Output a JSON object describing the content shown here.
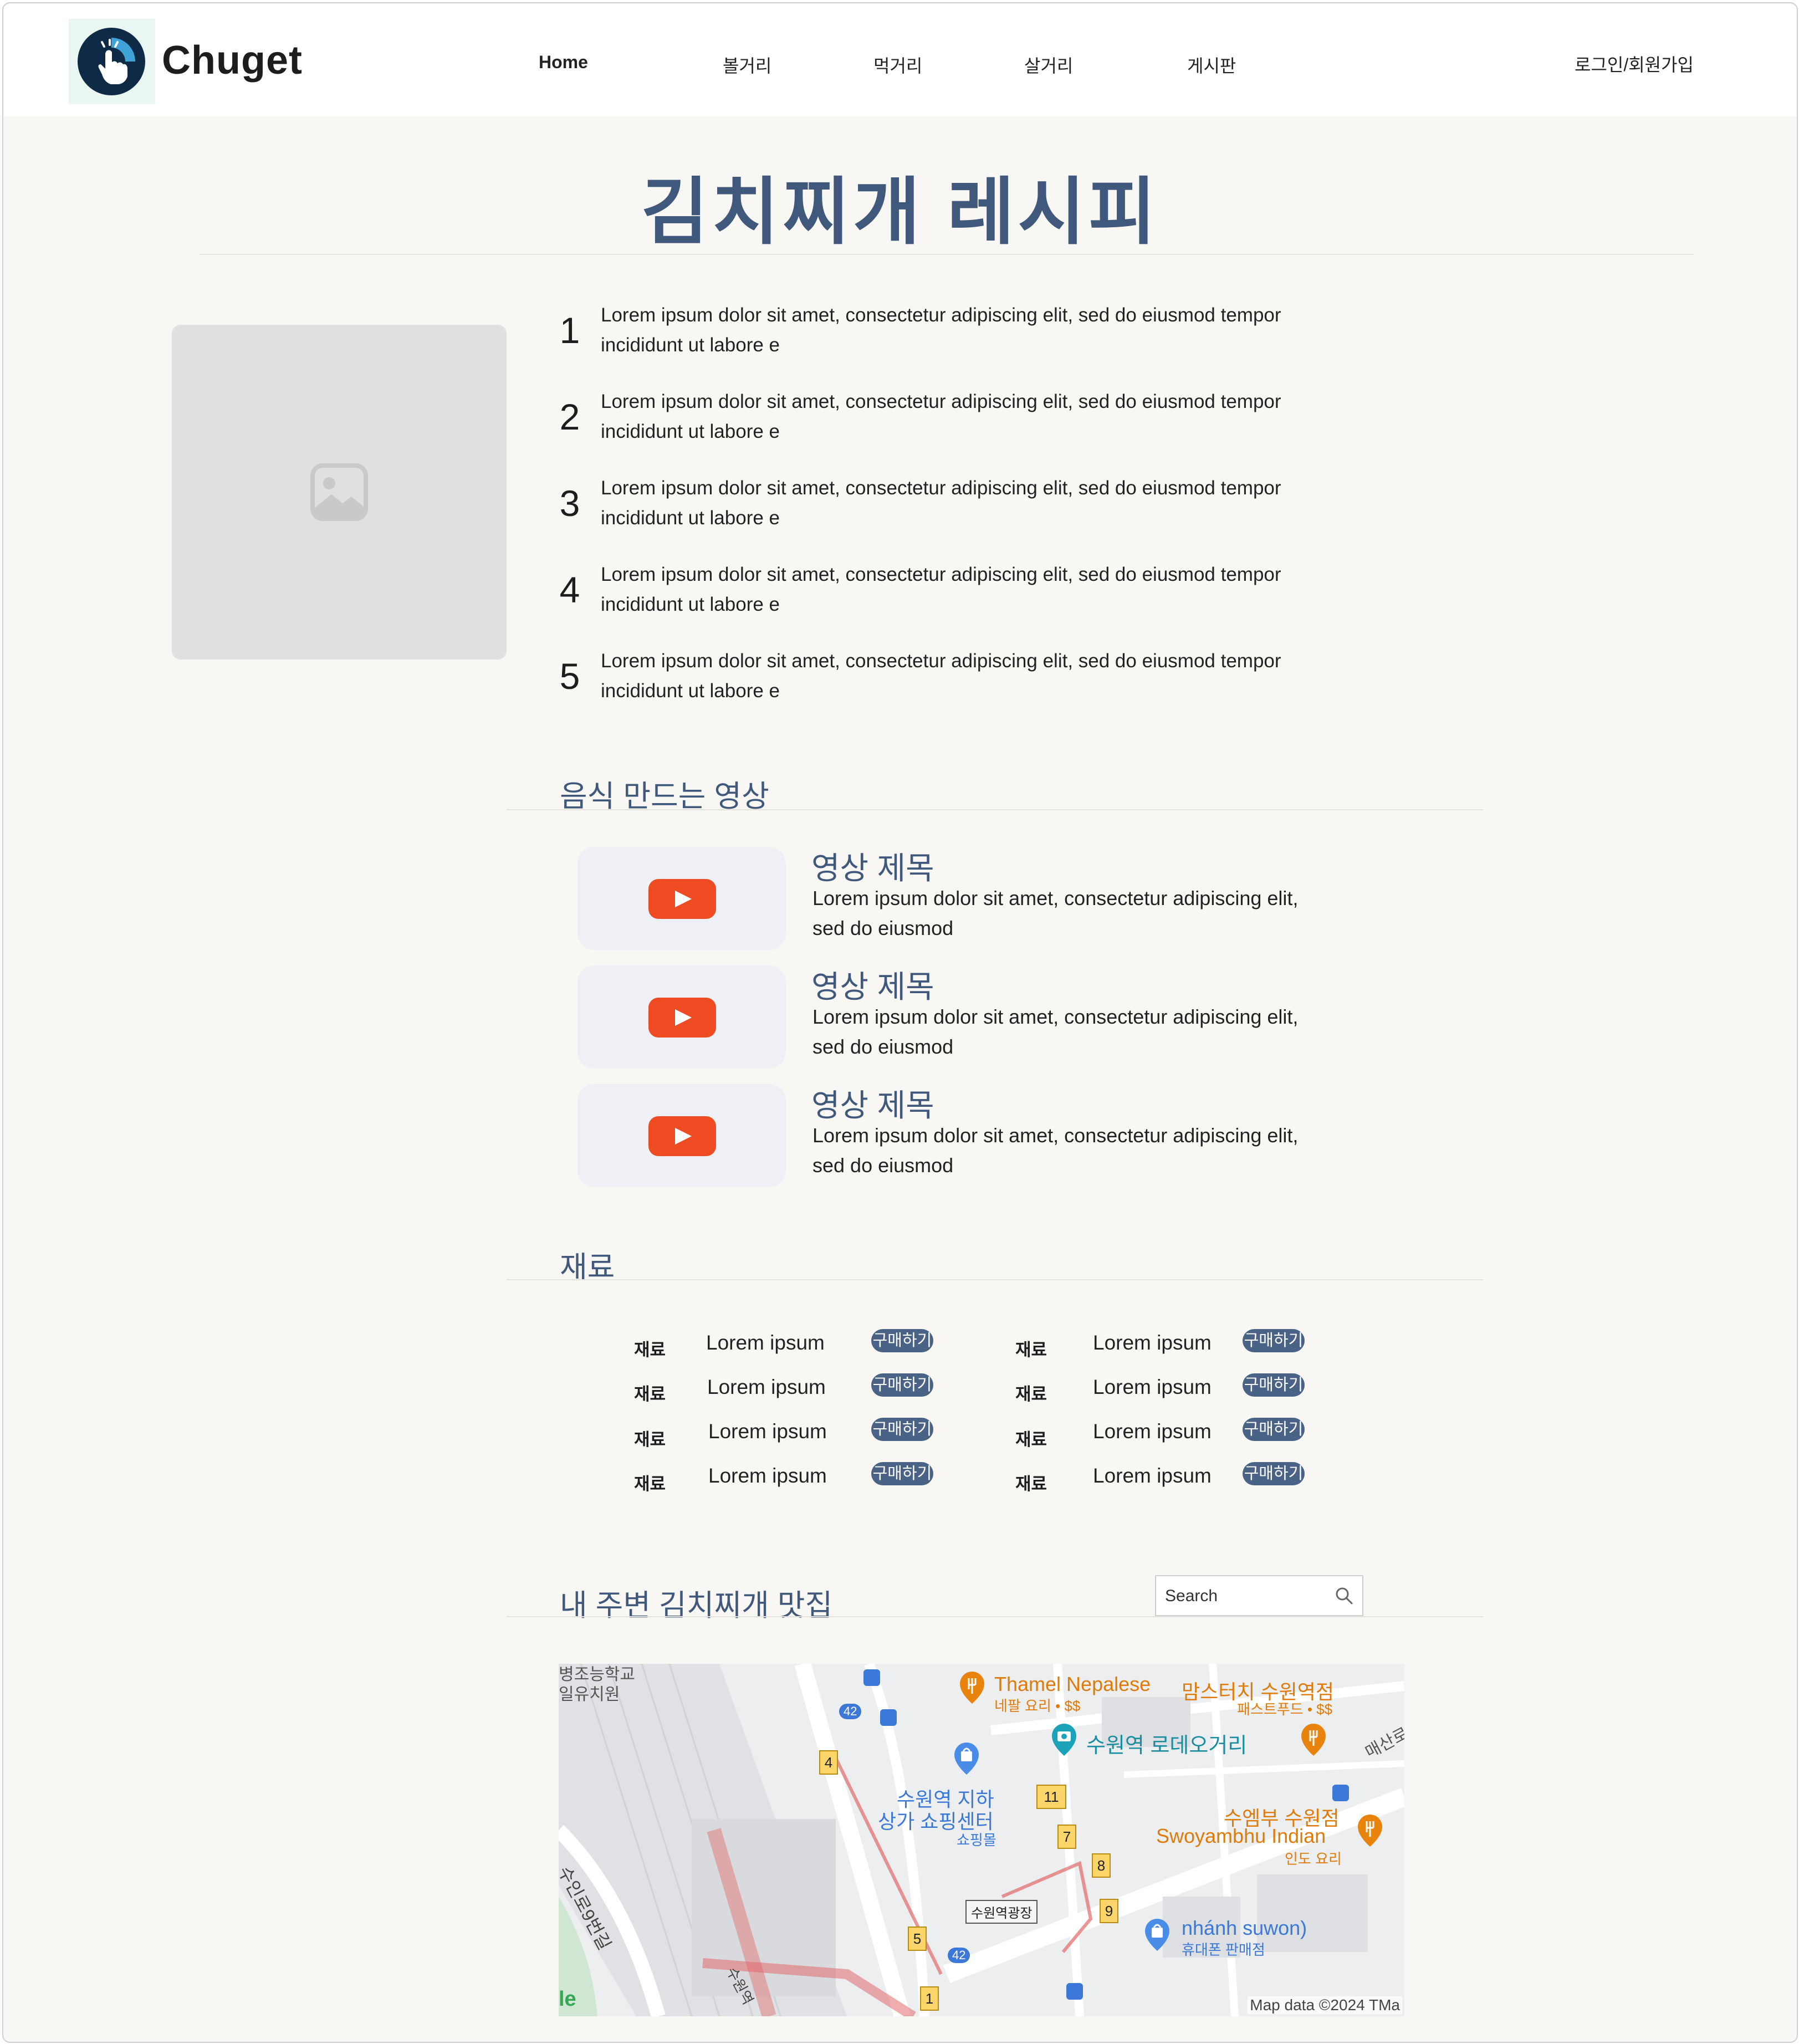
{
  "header": {
    "brand": "Chuget",
    "nav": [
      "Home",
      "볼거리",
      "먹거리",
      "살거리",
      "게시판"
    ],
    "login": "로그인/회원가입"
  },
  "recipe": {
    "title": "김치찌개 레시피",
    "steps": [
      {
        "num": "1",
        "line1": "Lorem ipsum dolor sit amet, consectetur adipiscing elit, sed do eiusmod tempor",
        "line2": "incididunt ut labore e"
      },
      {
        "num": "2",
        "line1": "Lorem ipsum dolor sit amet, consectetur adipiscing elit, sed do eiusmod tempor",
        "line2": "incididunt ut labore e"
      },
      {
        "num": "3",
        "line1": "Lorem ipsum dolor sit amet, consectetur adipiscing elit, sed do eiusmod tempor",
        "line2": "incididunt ut labore e"
      },
      {
        "num": "4",
        "line1": "Lorem ipsum dolor sit amet, consectetur adipiscing elit, sed do eiusmod tempor",
        "line2": "incididunt ut labore e"
      },
      {
        "num": "5",
        "line1": "Lorem ipsum dolor sit amet, consectetur adipiscing elit, sed do eiusmod tempor",
        "line2": "incididunt ut labore e"
      }
    ]
  },
  "videos": {
    "section_title": "음식 만드는 영상",
    "items": [
      {
        "title": "영상 제목",
        "line1": "Lorem ipsum dolor sit amet, consectetur adipiscing elit,",
        "line2": "sed do eiusmod"
      },
      {
        "title": "영상 제목",
        "line1": "Lorem ipsum dolor sit amet, consectetur adipiscing elit,",
        "line2": "sed do eiusmod"
      },
      {
        "title": "영상 제목",
        "line1": "Lorem ipsum dolor sit amet, consectetur adipiscing elit,",
        "line2": "sed do eiusmod"
      }
    ]
  },
  "ingredients": {
    "section_title": "재료",
    "label": "재료",
    "name": "Lorem ipsum",
    "buy_label": "구매하기",
    "rows": 4,
    "columns": 2
  },
  "nearby": {
    "section_title": "내 주변 김치찌개 맛집",
    "search_placeholder": "Search",
    "map": {
      "attribution": "Map data ©2024 TMa",
      "google_fragment": "le",
      "labels": {
        "school1": "병조능학교",
        "school2": "일유치원",
        "thamel": "Thamel Nepalese",
        "thamel_sub": "네팔 요리 • $$",
        "mom": "맘스터치 수원역점",
        "mom_sub": "패스트푸드 • $$",
        "rodeo": "수원역 로데오거리",
        "maesan": "매산로",
        "underground1": "수원역 지하",
        "underground2": "상가 쇼핑센터",
        "underground_sub": "쇼핑몰",
        "swoyambhu1": "수엠부 수원점",
        "swoyambhu2": "Swoyambhu Indian",
        "swoyambhu_sub": "인도 요리",
        "plaza": "수원역광장",
        "nhanh": "nhánh suwon)",
        "nhanh_sub": "휴대폰 판매점",
        "road": "수인로9번길",
        "station": "수원역"
      },
      "exits": [
        "4",
        "11",
        "7",
        "8",
        "9",
        "5",
        "1"
      ],
      "bus_numbers": [
        "42",
        "42"
      ],
      "colors": {
        "restaurant": "#e8830e",
        "attraction": "#1aa3b8",
        "shopping": "#4a8de8",
        "route": "#e26a6a"
      }
    }
  },
  "colors": {
    "accent": "#41587d",
    "button": "#4a6286",
    "youtube": "#ef4b23",
    "background": "#f8f7f3"
  }
}
